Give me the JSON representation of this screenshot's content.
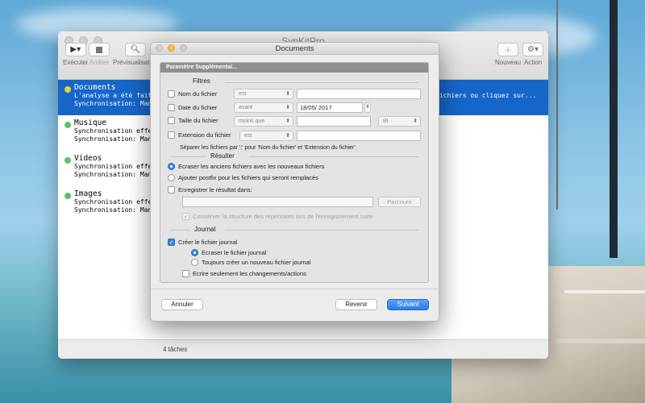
{
  "main_window": {
    "title": "SynKitPro",
    "toolbar": {
      "run": {
        "label": "Exécuter",
        "icon": "play-icon"
      },
      "stop": {
        "label": "Arrêter",
        "icon": "stop-icon"
      },
      "preview": {
        "label": "Prévisualisation",
        "icon": "magnifier-icon"
      },
      "new": {
        "label": "Nouveau",
        "icon": "plus-icon"
      },
      "action": {
        "label": "Action",
        "icon": "gear-icon"
      }
    },
    "tasks": [
      {
        "name": "Documents",
        "line1": "L'analyse a été faite",
        "line2": "Synchronisation: Manu",
        "right_text": "fichiers ou cliquez sur...",
        "status_color": "#f2c84b",
        "selected": true
      },
      {
        "name": "Musique",
        "line1": "Synchronisation effec",
        "line2": "Synchronisation: Manu",
        "status_color": "#5cc163",
        "selected": false
      },
      {
        "name": "Videos",
        "line1": "Synchronisation effec",
        "line2": "Synchronisation: Manu",
        "status_color": "#5cc163",
        "selected": false
      },
      {
        "name": "Images",
        "line1": "Synchronisation effec",
        "line2": "Synchronisation: Manu",
        "status_color": "#5cc163",
        "selected": false
      }
    ],
    "status": "4 tâches"
  },
  "dialog": {
    "title": "Documents",
    "panel_title": "Paramètre Supplémentai...",
    "filters": {
      "title": "Filtres",
      "rows": [
        {
          "label": "Nom du fichier",
          "operator": "est",
          "value": ""
        },
        {
          "label": "Date du fichier",
          "operator": "avant",
          "value": "18/05/ 2017"
        },
        {
          "label": "Taille du fichier",
          "operator": "moins que",
          "value": "",
          "unit": "Bt"
        },
        {
          "label": "Extension du fichier",
          "operator": "est",
          "value": ""
        }
      ],
      "note": "Séparer les fichiers par ';' pour 'Nom du fichier' et 'Extension du fichier'"
    },
    "result": {
      "title": "Résulter",
      "options": [
        {
          "label": "Ecraser les anciens fichiers avec les nouveaux fichiers",
          "selected": true
        },
        {
          "label": "Ajouter postfix pour les fichiers qui seront remplacés",
          "selected": false
        }
      ],
      "save_result_label": "Enregistrer le résultat dans:",
      "save_path": "",
      "browse_label": "Parcourir",
      "keep_structure_label": "Conserver la structure des répertoires lors de l'enregistrement suite"
    },
    "journal": {
      "title": "Journal",
      "create_label": "Créer le fichier journal",
      "options": [
        {
          "label": "Ecraser le fichier journal",
          "selected": true
        },
        {
          "label": "Toujours créer un nouveau fichier journal",
          "selected": false
        }
      ],
      "only_changes_label": "Ecrire seulement les changements/actions"
    },
    "buttons": {
      "cancel": "Annuler",
      "back": "Revenir",
      "next": "Suivant"
    }
  }
}
